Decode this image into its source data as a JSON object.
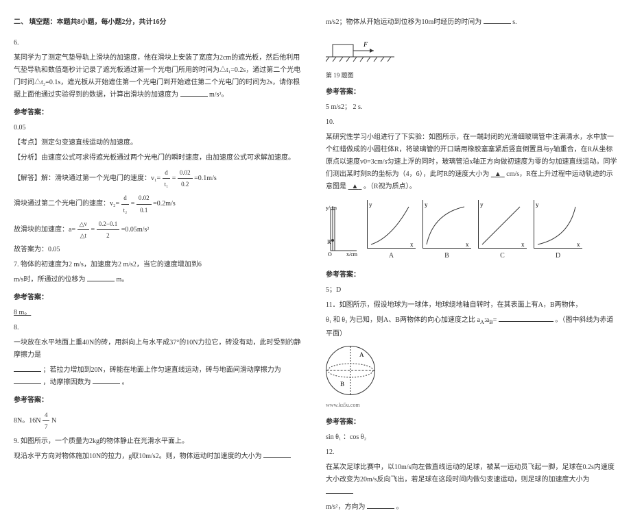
{
  "left": {
    "section_title": "二、 填空题：本题共8小题，每小题2分，共计16分",
    "q6": {
      "num": "6.",
      "text1": "某同学为了测定气垫导轨上滑块的加速度，他在滑块上安装了宽度为2cm的遮光板，然后他利用气垫导轨和数值毫秒计记录了遮光板通过第一个光电门所用的时间为△t₁=0.2s，通过第二个光电门时间△t₂=0.1s，遮光板从开始遮住第一个光电门到开始遮住第二个光电门的时间为2s，请你根据上面他通过实验得到的数据，计算出滑块的加速度为",
      "unit1": "m/s²。",
      "answer_label": "参考答案：",
      "answer": "0.05",
      "analysis_point": "【考点】测定匀变速直线运动的加速度。",
      "analysis1": "【分析】由速度公式可求得遮光板通过两个光电门的瞬时速度，由加速度公式可求解加速度。",
      "solution1": "【解答】解：滑块通过第一个光电门的速度：v₁=",
      "frac1_num": "d",
      "frac1_den": "t₁",
      "eq1": "=",
      "frac2_num": "0.02",
      "frac2_den": "0.2",
      "result1": "=0.1m/s",
      "solution2": "滑块通过第二个光电门的速度：v₂=",
      "frac3_num": "d",
      "frac3_den": "t₂",
      "eq2": "=",
      "frac4_num": "0.02",
      "frac4_den": "0.1",
      "result2": "=0.2m/s",
      "solution3": "故滑块的加速度：a=",
      "frac5_num": "△v",
      "frac5_den": "△t",
      "eq3": "=",
      "frac6_num": "0.2−0.1",
      "frac6_den": "2",
      "result3": "=0.05m/s²",
      "solution4": "故答案为：0.05"
    },
    "q7": {
      "text": "7. 物体的初速度为2 m/s，加速度为2 m/s2，当它的速度增加到6",
      "text2": "m/s时，所通过的位移为",
      "unit": "m。",
      "answer_label": "参考答案：",
      "answer": "8    m。"
    },
    "q8": {
      "num": "8.",
      "text1": "一块放在水平地面上重40N的砖，用斜向上与水平成37°的10N力拉它，砖没有动，此时受到的静摩擦力是",
      "text2": "；若拉力增加到20N，砖能在地面上作匀速直线运动，砖与地面间滑动摩擦力为",
      "text3": "，动摩擦因数为",
      "period": "。",
      "answer_label": "参考答案：",
      "answer": "8N。16N",
      "frac_num": "4",
      "frac_den": "7",
      "answer_suffix": "N"
    },
    "q9": {
      "text1": "9. 如图所示，一个质量为2kg的物体静止在光滑水平面上。",
      "text2": "现沿水平方向对物体施加10N的拉力，g取10m/s2。则，物体运动时加速度的大小为"
    }
  },
  "right": {
    "line1_prefix": "m/s2；物体从开始运动到位移为10m时经历的时间为",
    "line1_suffix": "s.",
    "fig_label": "第 19 题图",
    "answer_label1": "参考答案：",
    "answer1": "5  m/s2；        2    s.",
    "q10": {
      "num": "10.",
      "text1": "某研究性学习小组进行了下实验：如图所示，在一端封闭的光滑细玻璃管中注满清水，水中放一个红蜡做成的小圆柱体R，将玻璃管的开口端用橡胶塞塞紧后竖直倒置且与y轴重合，在R从坐标原点以速度v0=3cm/s匀速上浮的同时，玻璃管沿x轴正方向做初速度为零的匀加速直线运动。同学们测出某时刻R的坐标为（4，6），此时R的速度大小为",
      "blank1": "▲",
      "text2": "cm/s，R在上升过程中运动轨迹的示意图是",
      "blank2": "▲",
      "text3": "。（R视为质点）。",
      "chart_labels": [
        "A",
        "B",
        "C",
        "D"
      ],
      "answer_label": "参考答案：",
      "answer": "5；D"
    },
    "q11": {
      "text1": "11．如图所示，假设地球为一球体，地球绕地轴自转时，在其表面上有A，B两物体，",
      "text2_prefix": "和",
      "text2_suffix": "为已知，则A、B两物体的向心加速度之比",
      "blank1": "",
      "text3": "。（图中斜线为赤道平面）",
      "ks5u": "www.ks5u.com",
      "answer_label": "参考答案：",
      "answer": "sin θ₁ ：cos θ₂"
    },
    "q12": {
      "num": "12.",
      "text1": "在某次足球比赛中，以10m/s向左做直线运动的足球，被某一运动员飞起一脚，足球在0.2s内速度大小改变为20m/s反向飞出，若足球在这段时间内做匀变速运动，则足球的加速度大小为",
      "unit1": "m/s²，方向为",
      "period": "。"
    }
  }
}
